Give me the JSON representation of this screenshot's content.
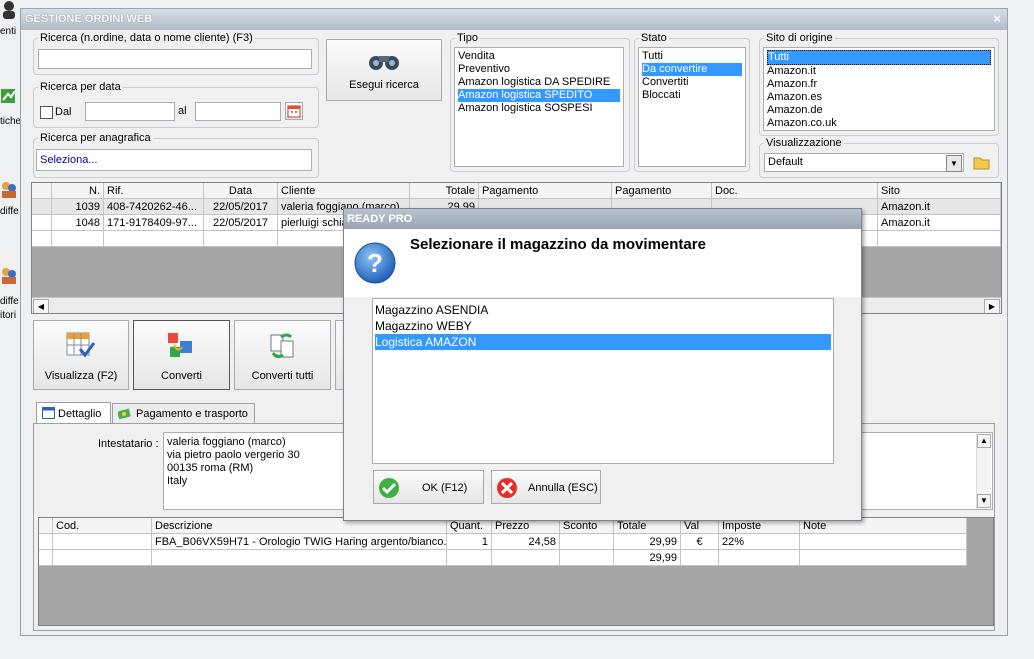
{
  "window": {
    "title": "GESTIONE ORDINI WEB",
    "close": "×"
  },
  "left_strip": {
    "items": [
      "enti",
      "tiche",
      "diffe",
      "diffe",
      "itori"
    ]
  },
  "search": {
    "text_group": "Ricerca (n.ordine, data o nome cliente) (F3)",
    "text_value": "",
    "date_group": "Ricerca per data",
    "date_from_label": "Dal",
    "date_to_label": "al",
    "anag_group": "Ricerca per anagrafica",
    "anag_value": "Seleziona...",
    "execute_label": "Esegui ricerca"
  },
  "tipo": {
    "label": "Tipo",
    "items": [
      "Vendita",
      "Preventivo",
      "Amazon logistica DA SPEDIRE",
      "Amazon logistica SPEDITO",
      "Amazon logistica SOSPESI"
    ],
    "selected": 3
  },
  "stato": {
    "label": "Stato",
    "items": [
      "Tutti",
      "Da convertire",
      "Convertiti",
      "Bloccati"
    ],
    "selected": 1
  },
  "sito": {
    "label": "Sito di origine",
    "items": [
      "Tutti",
      "Amazon.it",
      "Amazon.fr",
      "Amazon.es",
      "Amazon.de",
      "Amazon.co.uk"
    ],
    "selected": 0
  },
  "visualizzazione": {
    "label": "Visualizzazione",
    "value": "Default"
  },
  "orders": {
    "headers": [
      "",
      "N.",
      "Rif.",
      "Data",
      "Cliente",
      "Totale",
      "Pagamento",
      "Pagamento",
      "Doc.",
      "Sito"
    ],
    "rows": [
      [
        "",
        "1039",
        "408-7420262-46...",
        "22/05/2017",
        "valeria foggiano (marco)",
        "29,99",
        "",
        "",
        "",
        "Amazon.it"
      ],
      [
        "",
        "1048",
        "171-9178409-97...",
        "22/05/2017",
        "pierluigi schia",
        "",
        "",
        "",
        "",
        "Amazon.it"
      ]
    ]
  },
  "actions": [
    "Visualizza (F2)",
    "Converti",
    "Converti tutti"
  ],
  "tabs": [
    "Dettaglio",
    "Pagamento e trasporto"
  ],
  "detail": {
    "intestatario_label": "Intestatario :",
    "address": [
      "valeria foggiano (marco)",
      "via pietro paolo vergerio 30",
      "00135 roma (RM)",
      "Italy"
    ]
  },
  "lines": {
    "headers": [
      "",
      "Cod.",
      "Descrizione",
      "Quant.",
      "Prezzo",
      "Sconto",
      "Totale",
      "Val",
      "Imposte",
      "Note"
    ],
    "rows": [
      [
        "",
        "",
        "FBA_B06VX59H71 - Orologio TWIG Haring argento/bianco...",
        "1",
        "24,58",
        "",
        "29,99",
        "€",
        "22%",
        ""
      ],
      [
        "",
        "",
        "",
        "",
        "",
        "",
        "29,99",
        "",
        "",
        ""
      ]
    ]
  },
  "dialog": {
    "title": "READY PRO",
    "message": "Selezionare il magazzino da movimentare",
    "items": [
      "Magazzino ASENDIA",
      "Magazzino WEBY",
      "Logistica AMAZON"
    ],
    "selected": 2,
    "ok_label": "OK (F12)",
    "cancel_label": "Annulla (ESC)"
  },
  "colors": {
    "selection": "#3399ff",
    "grid_bg": "#a6a6a6",
    "title_bar": "#b3bcc8"
  }
}
